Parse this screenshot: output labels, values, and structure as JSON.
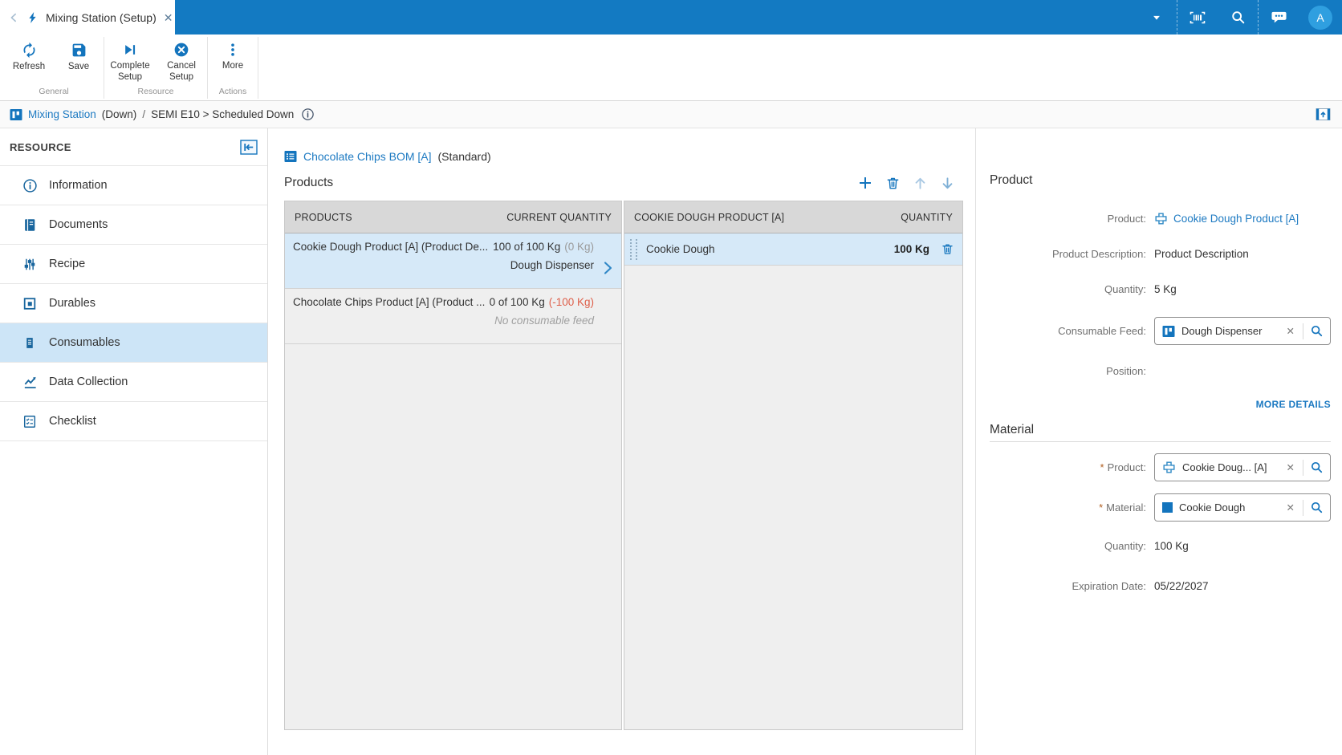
{
  "colors": {
    "topbar": "#137ac2",
    "accent": "#1374bd",
    "link": "#1d7ac2",
    "selected_row": "#d6e9f8",
    "sidebar_selected": "#cde5f7",
    "negative": "#de5f4a",
    "table_header": "#d8d8d8",
    "required": "#b05f21"
  },
  "topbar": {
    "tab_title": "Mixing Station (Setup)",
    "avatar_initial": "A"
  },
  "toolbar": {
    "refresh_label": "Refresh",
    "save_label": "Save",
    "complete_label": "Complete Setup",
    "cancel_label": "Cancel Setup",
    "more_label": "More",
    "group_general": "General",
    "group_resource": "Resource",
    "group_actions": "Actions"
  },
  "breadcrumb": {
    "resource": "Mixing Station",
    "state": "(Down)",
    "slash": "/",
    "reason": "SEMI E10 > Scheduled Down"
  },
  "sidebar": {
    "title": "RESOURCE",
    "items": [
      {
        "label": "Information",
        "icon": "info-icon",
        "selected": false
      },
      {
        "label": "Documents",
        "icon": "documents-icon",
        "selected": false
      },
      {
        "label": "Recipe",
        "icon": "recipe-icon",
        "selected": false
      },
      {
        "label": "Durables",
        "icon": "durables-icon",
        "selected": false
      },
      {
        "label": "Consumables",
        "icon": "consumables-icon",
        "selected": true
      },
      {
        "label": "Data Collection",
        "icon": "data-collection-icon",
        "selected": false
      },
      {
        "label": "Checklist",
        "icon": "checklist-icon",
        "selected": false
      }
    ]
  },
  "main": {
    "bom_link": "Chocolate Chips BOM [A]",
    "bom_type": "(Standard)",
    "section_title": "Products",
    "products_table": {
      "headers": [
        "PRODUCTS",
        "CURRENT QUANTITY"
      ],
      "rows": [
        {
          "name": "Cookie Dough Product [A] (Product De...",
          "quantity": "100 of 100 Kg",
          "delta": "(0 Kg)",
          "delta_state": "ok",
          "feed": "Dough Dispenser",
          "selected": true
        },
        {
          "name": "Chocolate Chips Product [A] (Product ...",
          "quantity": "0 of 100 Kg",
          "delta": "(-100 Kg)",
          "delta_state": "negative",
          "feed": "No consumable feed",
          "selected": false
        }
      ]
    },
    "materials_table": {
      "headers": [
        "COOKIE DOUGH PRODUCT [A]",
        "QUANTITY"
      ],
      "rows": [
        {
          "name": "Cookie Dough",
          "quantity": "100 Kg",
          "selected": true
        }
      ]
    }
  },
  "details": {
    "product": {
      "title": "Product",
      "product_label": "Product:",
      "product_value": "Cookie Dough Product [A]",
      "description_label": "Product Description:",
      "description_value": "Product Description",
      "quantity_label": "Quantity:",
      "quantity_value": "5 Kg",
      "feed_label": "Consumable Feed:",
      "feed_value": "Dough Dispenser",
      "position_label": "Position:",
      "position_value": "",
      "more_details": "MORE DETAILS"
    },
    "material": {
      "title": "Material",
      "required_marker": "*",
      "product_label": "Product:",
      "product_value": "Cookie Doug... [A]",
      "material_label": "Material:",
      "material_value": "Cookie Dough",
      "quantity_label": "Quantity:",
      "quantity_value": "100 Kg",
      "expiration_label": "Expiration Date:",
      "expiration_value": "05/22/2027"
    }
  }
}
